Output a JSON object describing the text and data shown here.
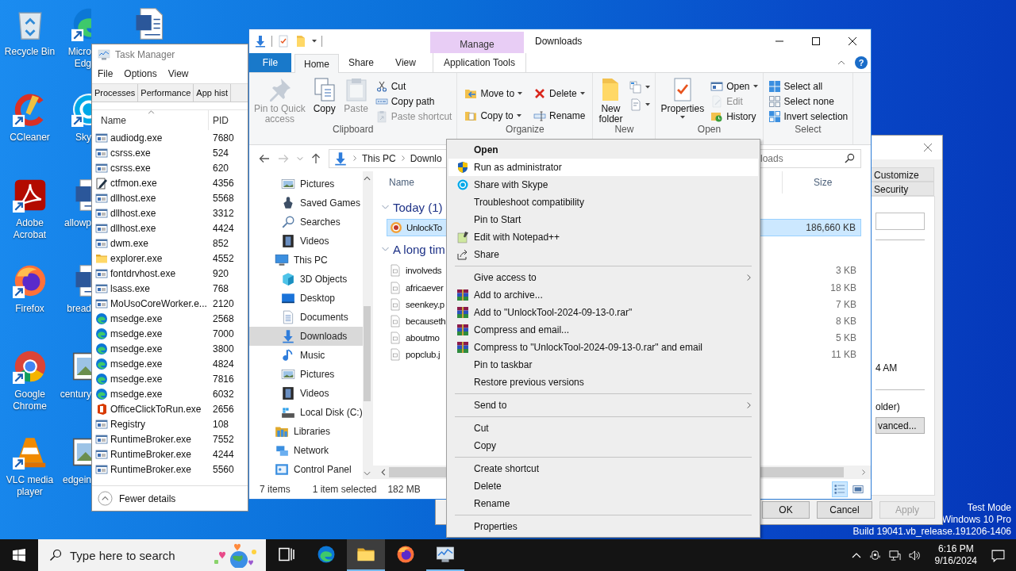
{
  "desktop": {
    "icon_columns": [
      [
        {
          "label": "Recycle Bin",
          "kind": "recycle",
          "shortcut": false
        },
        {
          "label": "CCleaner",
          "kind": "ccleaner",
          "shortcut": true
        },
        {
          "label": "Adobe Acrobat",
          "kind": "acrobat",
          "shortcut": true
        },
        {
          "label": "Firefox",
          "kind": "firefox",
          "shortcut": true
        },
        {
          "label": "Google Chrome",
          "kind": "chrome",
          "shortcut": true
        },
        {
          "label": "VLC media player",
          "kind": "vlc",
          "shortcut": true
        }
      ],
      [
        {
          "label": "Micro Edg",
          "kind": "edge",
          "shortcut": true
        },
        {
          "label": "Sky",
          "kind": "skype",
          "shortcut": true
        },
        {
          "label": "allowp",
          "kind": "word",
          "shortcut": false
        },
        {
          "label": "bread",
          "kind": "word",
          "shortcut": false
        },
        {
          "label": "century",
          "kind": "image",
          "shortcut": false
        },
        {
          "label": "edgein",
          "kind": "image",
          "shortcut": false
        }
      ],
      [
        {
          "kind": "word",
          "shortcut": false
        }
      ]
    ],
    "system_text": [
      "Test Mode",
      "Windows 10 Pro",
      "Build 19041.vb_release.191206-1406"
    ]
  },
  "properties_dialog": {
    "tabs": [
      "Customize",
      "Security"
    ],
    "visible_texts": [
      "4 AM",
      "older)"
    ],
    "advanced_button": "vanced...",
    "buttons": [
      {
        "label": "OK",
        "disabled": false
      },
      {
        "label": "Cancel",
        "disabled": false
      },
      {
        "label": "Apply",
        "disabled": true
      }
    ]
  },
  "task_manager": {
    "title": "Task Manager",
    "menu": [
      "File",
      "Options",
      "View"
    ],
    "tabs": [
      "Processes",
      "Performance",
      "App hist"
    ],
    "columns": [
      "Name",
      "PID"
    ],
    "processes": [
      {
        "name": "audiodg.exe",
        "pid": "7680",
        "kind": "exe"
      },
      {
        "name": "csrss.exe",
        "pid": "524",
        "kind": "exe"
      },
      {
        "name": "csrss.exe",
        "pid": "620",
        "kind": "exe"
      },
      {
        "name": "ctfmon.exe",
        "pid": "4356",
        "kind": "notepad"
      },
      {
        "name": "dllhost.exe",
        "pid": "5568",
        "kind": "exe"
      },
      {
        "name": "dllhost.exe",
        "pid": "3312",
        "kind": "exe"
      },
      {
        "name": "dllhost.exe",
        "pid": "4424",
        "kind": "exe"
      },
      {
        "name": "dwm.exe",
        "pid": "852",
        "kind": "exe"
      },
      {
        "name": "explorer.exe",
        "pid": "4552",
        "kind": "folder"
      },
      {
        "name": "fontdrvhost.exe",
        "pid": "920",
        "kind": "exe"
      },
      {
        "name": "lsass.exe",
        "pid": "768",
        "kind": "exe"
      },
      {
        "name": "MoUsoCoreWorker.e...",
        "pid": "2120",
        "kind": "exe"
      },
      {
        "name": "msedge.exe",
        "pid": "2568",
        "kind": "edge"
      },
      {
        "name": "msedge.exe",
        "pid": "7000",
        "kind": "edge"
      },
      {
        "name": "msedge.exe",
        "pid": "3800",
        "kind": "edge"
      },
      {
        "name": "msedge.exe",
        "pid": "4824",
        "kind": "edge"
      },
      {
        "name": "msedge.exe",
        "pid": "7816",
        "kind": "edge"
      },
      {
        "name": "msedge.exe",
        "pid": "6032",
        "kind": "edge"
      },
      {
        "name": "OfficeClickToRun.exe",
        "pid": "2656",
        "kind": "office"
      },
      {
        "name": "Registry",
        "pid": "108",
        "kind": "exe"
      },
      {
        "name": "RuntimeBroker.exe",
        "pid": "7552",
        "kind": "exe"
      },
      {
        "name": "RuntimeBroker.exe",
        "pid": "4244",
        "kind": "exe"
      },
      {
        "name": "RuntimeBroker.exe",
        "pid": "5560",
        "kind": "exe"
      }
    ],
    "footer": "Fewer details"
  },
  "explorer": {
    "title": "Downloads",
    "context_tab": "Manage",
    "help": "?",
    "ribbon_tabs": [
      {
        "label": "File",
        "kind": "file",
        "selected": false
      },
      {
        "label": "Home",
        "kind": "tab",
        "selected": true
      },
      {
        "label": "Share",
        "kind": "tab",
        "selected": false
      },
      {
        "label": "View",
        "kind": "tab",
        "selected": false
      },
      {
        "label": "Application Tools",
        "kind": "context",
        "selected": false
      }
    ],
    "ribbon_groups": [
      {
        "label": "Clipboard",
        "columns": [
          {
            "kind": "large",
            "items": [
              {
                "label": "Pin to Quick\naccess",
                "kind": "pin",
                "disabled": true,
                "dropdown": false
              }
            ]
          },
          {
            "kind": "large",
            "items": [
              {
                "label": "Copy",
                "kind": "copy",
                "disabled": false,
                "dropdown": false
              }
            ]
          },
          {
            "kind": "large",
            "items": [
              {
                "label": "Paste",
                "kind": "paste",
                "disabled": true,
                "dropdown": false
              }
            ]
          },
          {
            "kind": "stack",
            "items": [
              {
                "label": "Cut",
                "kind": "cut",
                "disabled": false,
                "dropdown": false
              },
              {
                "label": "Copy path",
                "kind": "copypath",
                "disabled": false,
                "dropdown": false
              },
              {
                "label": "Paste shortcut",
                "kind": "pasteshortcut",
                "disabled": true,
                "dropdown": false
              }
            ]
          }
        ]
      },
      {
        "label": "Organize",
        "columns": [
          {
            "kind": "stack2",
            "items": [
              {
                "label": "Move to",
                "kind": "moveto",
                "disabled": false,
                "dropdown": true
              },
              {
                "label": "Copy to",
                "kind": "copyto",
                "disabled": false,
                "dropdown": true
              }
            ]
          },
          {
            "kind": "stack2",
            "items": [
              {
                "label": "Delete",
                "kind": "delete",
                "disabled": false,
                "dropdown": true
              },
              {
                "label": "Rename",
                "kind": "rename",
                "disabled": false,
                "dropdown": false
              }
            ]
          }
        ]
      },
      {
        "label": "New",
        "columns": [
          {
            "kind": "large",
            "items": [
              {
                "label": "New\nfolder",
                "kind": "newfolder",
                "disabled": false,
                "dropdown": false
              }
            ]
          },
          {
            "kind": "stack",
            "items": [
              {
                "kind": "newitem",
                "disabled": false,
                "dropdown": true
              },
              {
                "kind": "easyaccess",
                "disabled": false,
                "dropdown": true
              }
            ]
          }
        ]
      },
      {
        "label": "Open",
        "columns": [
          {
            "kind": "large",
            "items": [
              {
                "label": "Properties",
                "kind": "properties",
                "disabled": false,
                "dropdown": true
              }
            ]
          },
          {
            "kind": "stack",
            "items": [
              {
                "label": "Open",
                "kind": "open",
                "disabled": false,
                "dropdown": true
              },
              {
                "label": "Edit",
                "kind": "edit",
                "disabled": true,
                "dropdown": false
              },
              {
                "label": "History",
                "kind": "history",
                "disabled": false,
                "dropdown": false
              }
            ]
          }
        ]
      },
      {
        "label": "Select",
        "columns": [
          {
            "kind": "stack",
            "items": [
              {
                "label": "Select all",
                "kind": "selectall",
                "disabled": false,
                "dropdown": false
              },
              {
                "label": "Select none",
                "kind": "selectnone",
                "disabled": false,
                "dropdown": false
              },
              {
                "label": "Invert selection",
                "kind": "invert",
                "disabled": false,
                "dropdown": false
              }
            ]
          }
        ]
      }
    ],
    "address": {
      "path": [
        "This PC",
        "Downlo"
      ]
    },
    "search": {
      "placeholder": "loads"
    },
    "nav_pane": {
      "continued_children": [
        {
          "label": "Pictures",
          "kind": "pictures",
          "selected": false
        },
        {
          "label": "Saved Games",
          "kind": "savedgames",
          "selected": false
        },
        {
          "label": "Searches",
          "kind": "searches",
          "selected": false
        },
        {
          "label": "Videos",
          "kind": "videos",
          "selected": false
        }
      ],
      "items": [
        {
          "label": "This PC",
          "kind": "thispc",
          "selected": false,
          "children": [
            {
              "label": "3D Objects",
              "kind": "cube",
              "selected": false
            },
            {
              "label": "Desktop",
              "kind": "desktop",
              "selected": false
            },
            {
              "label": "Documents",
              "kind": "documents",
              "selected": false
            },
            {
              "label": "Downloads",
              "kind": "downloads",
              "selected": true
            },
            {
              "label": "Music",
              "kind": "music",
              "selected": false
            },
            {
              "label": "Pictures",
              "kind": "pictures",
              "selected": false
            },
            {
              "label": "Videos",
              "kind": "videos",
              "selected": false
            },
            {
              "label": "Local Disk (C:)",
              "kind": "disk",
              "selected": false
            }
          ]
        },
        {
          "label": "Libraries",
          "kind": "libraries",
          "selected": false
        },
        {
          "label": "Network",
          "kind": "network",
          "selected": false
        },
        {
          "label": "Control Panel",
          "kind": "control",
          "selected": false
        }
      ]
    },
    "file_list": {
      "columns": [
        "Name",
        "Size"
      ],
      "groups": [
        {
          "label": "Today (1)",
          "expanded": true,
          "files": [
            {
              "name": "UnlockTo",
              "size": "186,660 KB",
              "kind": "unlock",
              "selected": true
            }
          ]
        },
        {
          "label": "A long tim",
          "expanded": true,
          "files": [
            {
              "name": "involveds",
              "size": "3 KB",
              "kind": "file",
              "selected": false
            },
            {
              "name": "africaever",
              "size": "18 KB",
              "kind": "file",
              "selected": false
            },
            {
              "name": "seenkey.p",
              "size": "7 KB",
              "kind": "file",
              "selected": false
            },
            {
              "name": "becauseth",
              "size": "8 KB",
              "kind": "file",
              "selected": false
            },
            {
              "name": "aboutmo",
              "size": "5 KB",
              "kind": "file",
              "selected": false
            },
            {
              "name": "popclub.j",
              "size": "11 KB",
              "kind": "file",
              "selected": false
            }
          ]
        }
      ]
    },
    "status_bar": {
      "item_count": "7 items",
      "selection": "1 item selected",
      "selection_size": "182 MB",
      "views": [
        {
          "kind": "details",
          "selected": true
        },
        {
          "kind": "large",
          "selected": false
        }
      ]
    }
  },
  "context_menu": {
    "items": [
      {
        "kind": "plain",
        "label": "Open",
        "default": true,
        "selected": false,
        "submenu": false
      },
      {
        "kind": "shield",
        "label": "Run as administrator",
        "default": false,
        "selected": true,
        "submenu": false
      },
      {
        "kind": "skype",
        "label": "Share with Skype",
        "default": false,
        "selected": false,
        "submenu": false
      },
      {
        "kind": "plain",
        "label": "Troubleshoot compatibility",
        "default": false,
        "selected": false,
        "submenu": false
      },
      {
        "kind": "plain",
        "label": "Pin to Start",
        "default": false,
        "selected": false,
        "submenu": false
      },
      {
        "kind": "npp",
        "label": "Edit with Notepad++",
        "default": false,
        "selected": false,
        "submenu": false
      },
      {
        "kind": "share",
        "label": "Share",
        "default": false,
        "selected": false,
        "submenu": false
      },
      {
        "kind": "separator"
      },
      {
        "kind": "plain",
        "label": "Give access to",
        "default": false,
        "selected": false,
        "submenu": true
      },
      {
        "kind": "rar",
        "label": "Add to archive...",
        "default": false,
        "selected": false,
        "submenu": false
      },
      {
        "kind": "rar",
        "label": "Add to \"UnlockTool-2024-09-13-0.rar\"",
        "default": false,
        "selected": false,
        "submenu": false
      },
      {
        "kind": "rar",
        "label": "Compress and email...",
        "default": false,
        "selected": false,
        "submenu": false
      },
      {
        "kind": "rar",
        "label": "Compress to \"UnlockTool-2024-09-13-0.rar\" and email",
        "default": false,
        "selected": false,
        "submenu": false
      },
      {
        "kind": "plain",
        "label": "Pin to taskbar",
        "default": false,
        "selected": false,
        "submenu": false
      },
      {
        "kind": "plain",
        "label": "Restore previous versions",
        "default": false,
        "selected": false,
        "submenu": false
      },
      {
        "kind": "separator"
      },
      {
        "kind": "plain",
        "label": "Send to",
        "default": false,
        "selected": false,
        "submenu": true
      },
      {
        "kind": "separator"
      },
      {
        "kind": "plain",
        "label": "Cut",
        "default": false,
        "selected": false,
        "submenu": false
      },
      {
        "kind": "plain",
        "label": "Copy",
        "default": false,
        "selected": false,
        "submenu": false
      },
      {
        "kind": "separator"
      },
      {
        "kind": "plain",
        "label": "Create shortcut",
        "default": false,
        "selected": false,
        "submenu": false
      },
      {
        "kind": "plain",
        "label": "Delete",
        "default": false,
        "selected": false,
        "submenu": false
      },
      {
        "kind": "plain",
        "label": "Rename",
        "default": false,
        "selected": false,
        "submenu": false
      },
      {
        "kind": "separator"
      },
      {
        "kind": "plain",
        "label": "Properties",
        "default": false,
        "selected": false,
        "submenu": false
      }
    ]
  },
  "taskbar": {
    "search": {
      "placeholder": "Type here to search"
    },
    "apps": [
      {
        "kind": "taskview",
        "active": false,
        "running": false
      },
      {
        "kind": "edge",
        "active": false,
        "running": false
      },
      {
        "kind": "folder",
        "active": true,
        "running": true
      },
      {
        "kind": "firefox",
        "active": false,
        "running": false
      },
      {
        "kind": "taskmgr",
        "active": false,
        "running": true
      }
    ],
    "clock": {
      "time": "6:16 PM",
      "date": "9/16/2024"
    }
  }
}
